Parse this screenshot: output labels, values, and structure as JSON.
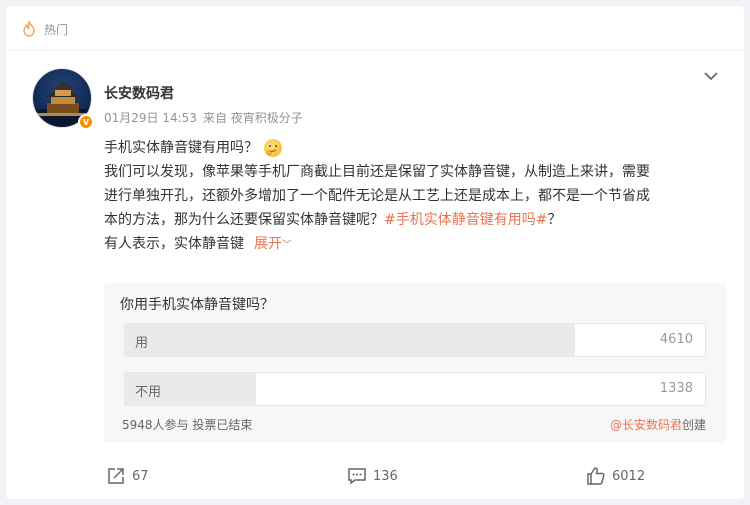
{
  "header": {
    "label": "热门",
    "icon": "hot-flame-icon"
  },
  "author": {
    "name": "长安数码君",
    "verified_badge": "V",
    "time": "01月29日 14:53",
    "source": "来自 夜宵积极分子"
  },
  "post": {
    "title": "手机实体静音键有用吗？",
    "body_text": "我们可以发现，像苹果等手机厂商截止目前还是保留了实体静音键，从制造上来讲，需要进行单独开孔，还额外多增加了一个配件无论是从工艺上还是成本上，都不是一个节省成本的方法，那为什么还要保留实体静音键呢？",
    "topic": "#手机实体静音键有用吗#",
    "body_tail": "？",
    "summary": "有人表示，实体静音键",
    "expand_label": "展开",
    "expand_chevron": "﹀"
  },
  "poll": {
    "question": "你用手机实体静音键吗？",
    "options": [
      {
        "label": "用",
        "count": "4610",
        "fraction": 0.775
      },
      {
        "label": "不用",
        "count": "1338",
        "fraction": 0.225
      }
    ],
    "footer": "5948人参与 投票已结束",
    "creator_at": "@长安数码君",
    "creator_suffix": "创建"
  },
  "actions": {
    "share_count": "67",
    "comment_count": "136",
    "like_count": "6012"
  },
  "colors": {
    "accent": "#eb7350",
    "badge": "#f29100"
  }
}
